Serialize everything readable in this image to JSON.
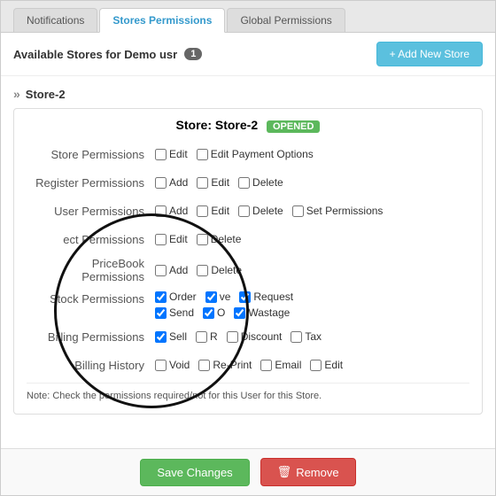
{
  "header": {
    "tabs": [
      {
        "id": "notifications",
        "label": "Notifications",
        "active": false
      },
      {
        "id": "stores-permissions",
        "label": "Stores Permissions",
        "active": true
      },
      {
        "id": "global-permissions",
        "label": "Global Permissions",
        "active": false
      }
    ]
  },
  "toolbar": {
    "available_label": "Available Stores for Demo usr",
    "store_count": "1",
    "add_button_label": "+ Add New Store"
  },
  "store": {
    "name": "Store-2",
    "title": "Store: Store-2",
    "status": "OPENED",
    "permissions": [
      {
        "label": "Store Permissions",
        "options": [
          {
            "name": "Edit",
            "checked": false
          },
          {
            "name": "Edit Payment Options",
            "checked": false
          }
        ]
      },
      {
        "label": "Register Permissions",
        "options": [
          {
            "name": "Add",
            "checked": false
          },
          {
            "name": "Edit",
            "checked": false
          },
          {
            "name": "Delete",
            "checked": false
          }
        ]
      },
      {
        "label": "User Permissions",
        "options": [
          {
            "name": "Add",
            "checked": false
          },
          {
            "name": "Edit",
            "checked": false
          },
          {
            "name": "Delete",
            "checked": false
          },
          {
            "name": "Set Permissions",
            "checked": false
          }
        ]
      },
      {
        "label": "ect Permissions",
        "options": [
          {
            "name": "Edit",
            "checked": false
          },
          {
            "name": "Delete",
            "checked": false
          }
        ]
      },
      {
        "label": "PriceBook Permissions",
        "options": [
          {
            "name": "Add",
            "checked": false
          },
          {
            "name": "Delete",
            "checked": false
          }
        ]
      },
      {
        "label": "Stock Permissions",
        "row1": [
          {
            "name": "Order",
            "checked": true
          },
          {
            "name": "ve",
            "checked": true
          },
          {
            "name": "Request",
            "checked": true
          }
        ],
        "row2": [
          {
            "name": "Send",
            "checked": true
          },
          {
            "name": "O",
            "checked": true
          },
          {
            "name": "Wastage",
            "checked": true
          }
        ]
      },
      {
        "label": "Billing Permissions",
        "options": [
          {
            "name": "Sell",
            "checked": true
          },
          {
            "name": "R",
            "checked": false
          },
          {
            "name": "Discount",
            "checked": false
          },
          {
            "name": "Tax",
            "checked": false
          }
        ]
      },
      {
        "label": "Billing History",
        "options": [
          {
            "name": "Void",
            "checked": false
          },
          {
            "name": "Re-Print",
            "checked": false
          },
          {
            "name": "Email",
            "checked": false
          },
          {
            "name": "Edit",
            "checked": false
          }
        ]
      }
    ],
    "note": "Note: Check the permissions required/not for this User for this Store."
  },
  "footer": {
    "save_label": "Save Changes",
    "remove_label": "Remove"
  }
}
